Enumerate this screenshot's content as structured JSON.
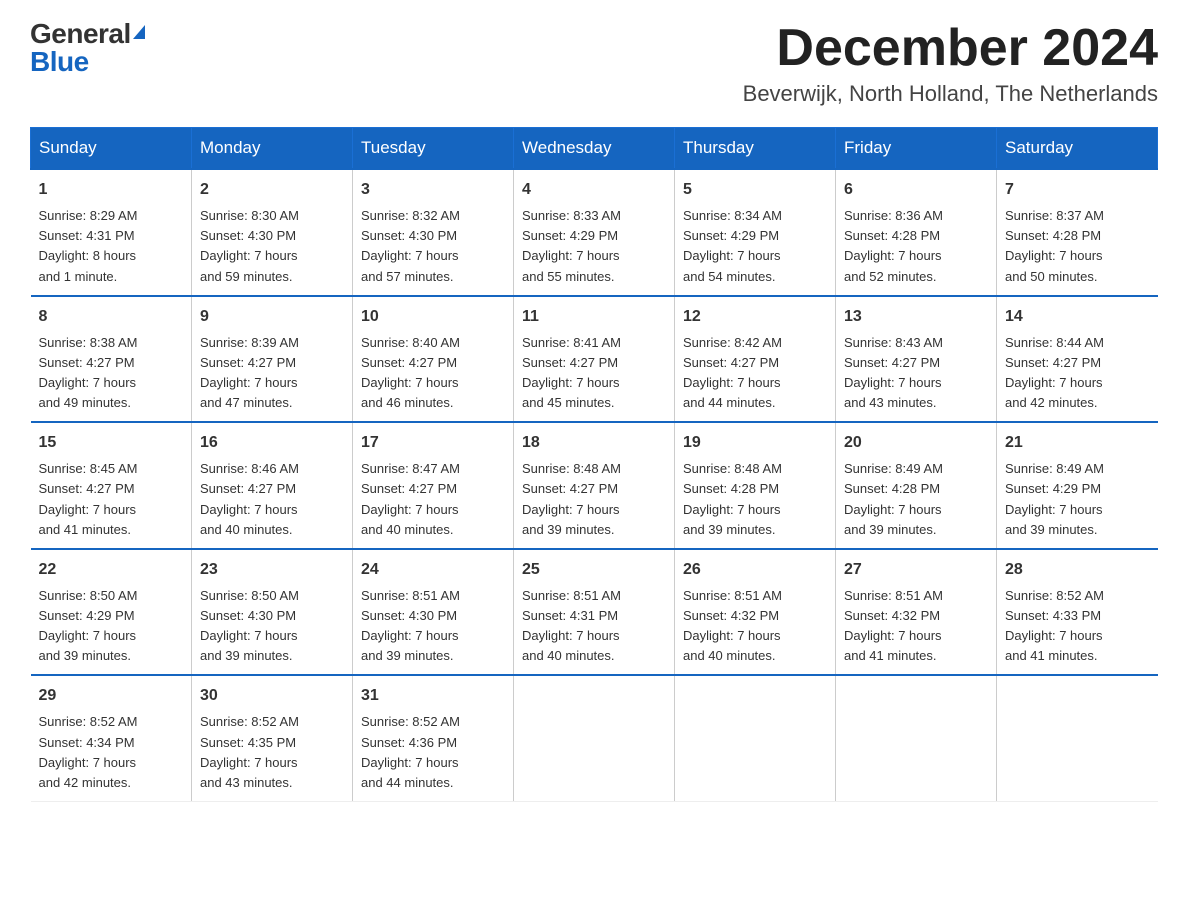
{
  "logo": {
    "general": "General",
    "blue": "Blue"
  },
  "title": "December 2024",
  "location": "Beverwijk, North Holland, The Netherlands",
  "days_of_week": [
    "Sunday",
    "Monday",
    "Tuesday",
    "Wednesday",
    "Thursday",
    "Friday",
    "Saturday"
  ],
  "weeks": [
    [
      {
        "day": "1",
        "info": "Sunrise: 8:29 AM\nSunset: 4:31 PM\nDaylight: 8 hours\nand 1 minute."
      },
      {
        "day": "2",
        "info": "Sunrise: 8:30 AM\nSunset: 4:30 PM\nDaylight: 7 hours\nand 59 minutes."
      },
      {
        "day": "3",
        "info": "Sunrise: 8:32 AM\nSunset: 4:30 PM\nDaylight: 7 hours\nand 57 minutes."
      },
      {
        "day": "4",
        "info": "Sunrise: 8:33 AM\nSunset: 4:29 PM\nDaylight: 7 hours\nand 55 minutes."
      },
      {
        "day": "5",
        "info": "Sunrise: 8:34 AM\nSunset: 4:29 PM\nDaylight: 7 hours\nand 54 minutes."
      },
      {
        "day": "6",
        "info": "Sunrise: 8:36 AM\nSunset: 4:28 PM\nDaylight: 7 hours\nand 52 minutes."
      },
      {
        "day": "7",
        "info": "Sunrise: 8:37 AM\nSunset: 4:28 PM\nDaylight: 7 hours\nand 50 minutes."
      }
    ],
    [
      {
        "day": "8",
        "info": "Sunrise: 8:38 AM\nSunset: 4:27 PM\nDaylight: 7 hours\nand 49 minutes."
      },
      {
        "day": "9",
        "info": "Sunrise: 8:39 AM\nSunset: 4:27 PM\nDaylight: 7 hours\nand 47 minutes."
      },
      {
        "day": "10",
        "info": "Sunrise: 8:40 AM\nSunset: 4:27 PM\nDaylight: 7 hours\nand 46 minutes."
      },
      {
        "day": "11",
        "info": "Sunrise: 8:41 AM\nSunset: 4:27 PM\nDaylight: 7 hours\nand 45 minutes."
      },
      {
        "day": "12",
        "info": "Sunrise: 8:42 AM\nSunset: 4:27 PM\nDaylight: 7 hours\nand 44 minutes."
      },
      {
        "day": "13",
        "info": "Sunrise: 8:43 AM\nSunset: 4:27 PM\nDaylight: 7 hours\nand 43 minutes."
      },
      {
        "day": "14",
        "info": "Sunrise: 8:44 AM\nSunset: 4:27 PM\nDaylight: 7 hours\nand 42 minutes."
      }
    ],
    [
      {
        "day": "15",
        "info": "Sunrise: 8:45 AM\nSunset: 4:27 PM\nDaylight: 7 hours\nand 41 minutes."
      },
      {
        "day": "16",
        "info": "Sunrise: 8:46 AM\nSunset: 4:27 PM\nDaylight: 7 hours\nand 40 minutes."
      },
      {
        "day": "17",
        "info": "Sunrise: 8:47 AM\nSunset: 4:27 PM\nDaylight: 7 hours\nand 40 minutes."
      },
      {
        "day": "18",
        "info": "Sunrise: 8:48 AM\nSunset: 4:27 PM\nDaylight: 7 hours\nand 39 minutes."
      },
      {
        "day": "19",
        "info": "Sunrise: 8:48 AM\nSunset: 4:28 PM\nDaylight: 7 hours\nand 39 minutes."
      },
      {
        "day": "20",
        "info": "Sunrise: 8:49 AM\nSunset: 4:28 PM\nDaylight: 7 hours\nand 39 minutes."
      },
      {
        "day": "21",
        "info": "Sunrise: 8:49 AM\nSunset: 4:29 PM\nDaylight: 7 hours\nand 39 minutes."
      }
    ],
    [
      {
        "day": "22",
        "info": "Sunrise: 8:50 AM\nSunset: 4:29 PM\nDaylight: 7 hours\nand 39 minutes."
      },
      {
        "day": "23",
        "info": "Sunrise: 8:50 AM\nSunset: 4:30 PM\nDaylight: 7 hours\nand 39 minutes."
      },
      {
        "day": "24",
        "info": "Sunrise: 8:51 AM\nSunset: 4:30 PM\nDaylight: 7 hours\nand 39 minutes."
      },
      {
        "day": "25",
        "info": "Sunrise: 8:51 AM\nSunset: 4:31 PM\nDaylight: 7 hours\nand 40 minutes."
      },
      {
        "day": "26",
        "info": "Sunrise: 8:51 AM\nSunset: 4:32 PM\nDaylight: 7 hours\nand 40 minutes."
      },
      {
        "day": "27",
        "info": "Sunrise: 8:51 AM\nSunset: 4:32 PM\nDaylight: 7 hours\nand 41 minutes."
      },
      {
        "day": "28",
        "info": "Sunrise: 8:52 AM\nSunset: 4:33 PM\nDaylight: 7 hours\nand 41 minutes."
      }
    ],
    [
      {
        "day": "29",
        "info": "Sunrise: 8:52 AM\nSunset: 4:34 PM\nDaylight: 7 hours\nand 42 minutes."
      },
      {
        "day": "30",
        "info": "Sunrise: 8:52 AM\nSunset: 4:35 PM\nDaylight: 7 hours\nand 43 minutes."
      },
      {
        "day": "31",
        "info": "Sunrise: 8:52 AM\nSunset: 4:36 PM\nDaylight: 7 hours\nand 44 minutes."
      },
      {
        "day": "",
        "info": ""
      },
      {
        "day": "",
        "info": ""
      },
      {
        "day": "",
        "info": ""
      },
      {
        "day": "",
        "info": ""
      }
    ]
  ]
}
